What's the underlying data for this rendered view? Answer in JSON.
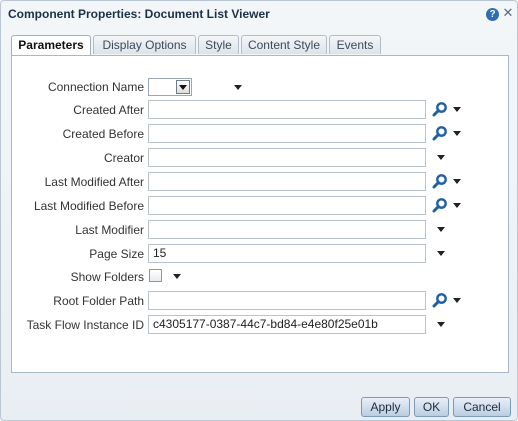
{
  "dialog": {
    "title": "Component Properties: Document List Viewer",
    "help_icon": "?",
    "close_icon": "✕"
  },
  "tabs": [
    {
      "label": "Parameters",
      "active": true
    },
    {
      "label": "Display Options",
      "active": false
    },
    {
      "label": "Style",
      "active": false
    },
    {
      "label": "Content Style",
      "active": false
    },
    {
      "label": "Events",
      "active": false
    }
  ],
  "fields": {
    "connection_name": {
      "label": "Connection Name",
      "value": ""
    },
    "created_after": {
      "label": "Created After",
      "value": ""
    },
    "created_before": {
      "label": "Created Before",
      "value": ""
    },
    "creator": {
      "label": "Creator",
      "value": ""
    },
    "last_modified_after": {
      "label": "Last Modified After",
      "value": ""
    },
    "last_modified_before": {
      "label": "Last Modified Before",
      "value": ""
    },
    "last_modifier": {
      "label": "Last Modifier",
      "value": ""
    },
    "page_size": {
      "label": "Page Size",
      "value": "15"
    },
    "show_folders": {
      "label": "Show Folders",
      "checked": false
    },
    "root_folder_path": {
      "label": "Root Folder Path",
      "value": ""
    },
    "task_flow_instance_id": {
      "label": "Task Flow Instance ID",
      "value": "c4305177-0387-44c7-bd84-e4e80f25e01b"
    }
  },
  "buttons": {
    "apply": "Apply",
    "ok": "OK",
    "cancel": "Cancel"
  },
  "icons": {
    "search": "search-icon",
    "dropdown": "caret-down-icon",
    "help": "help-icon"
  },
  "colors": {
    "accent": "#2d6db5",
    "title": "#1c3147",
    "button_border": "#7d9ab8"
  }
}
